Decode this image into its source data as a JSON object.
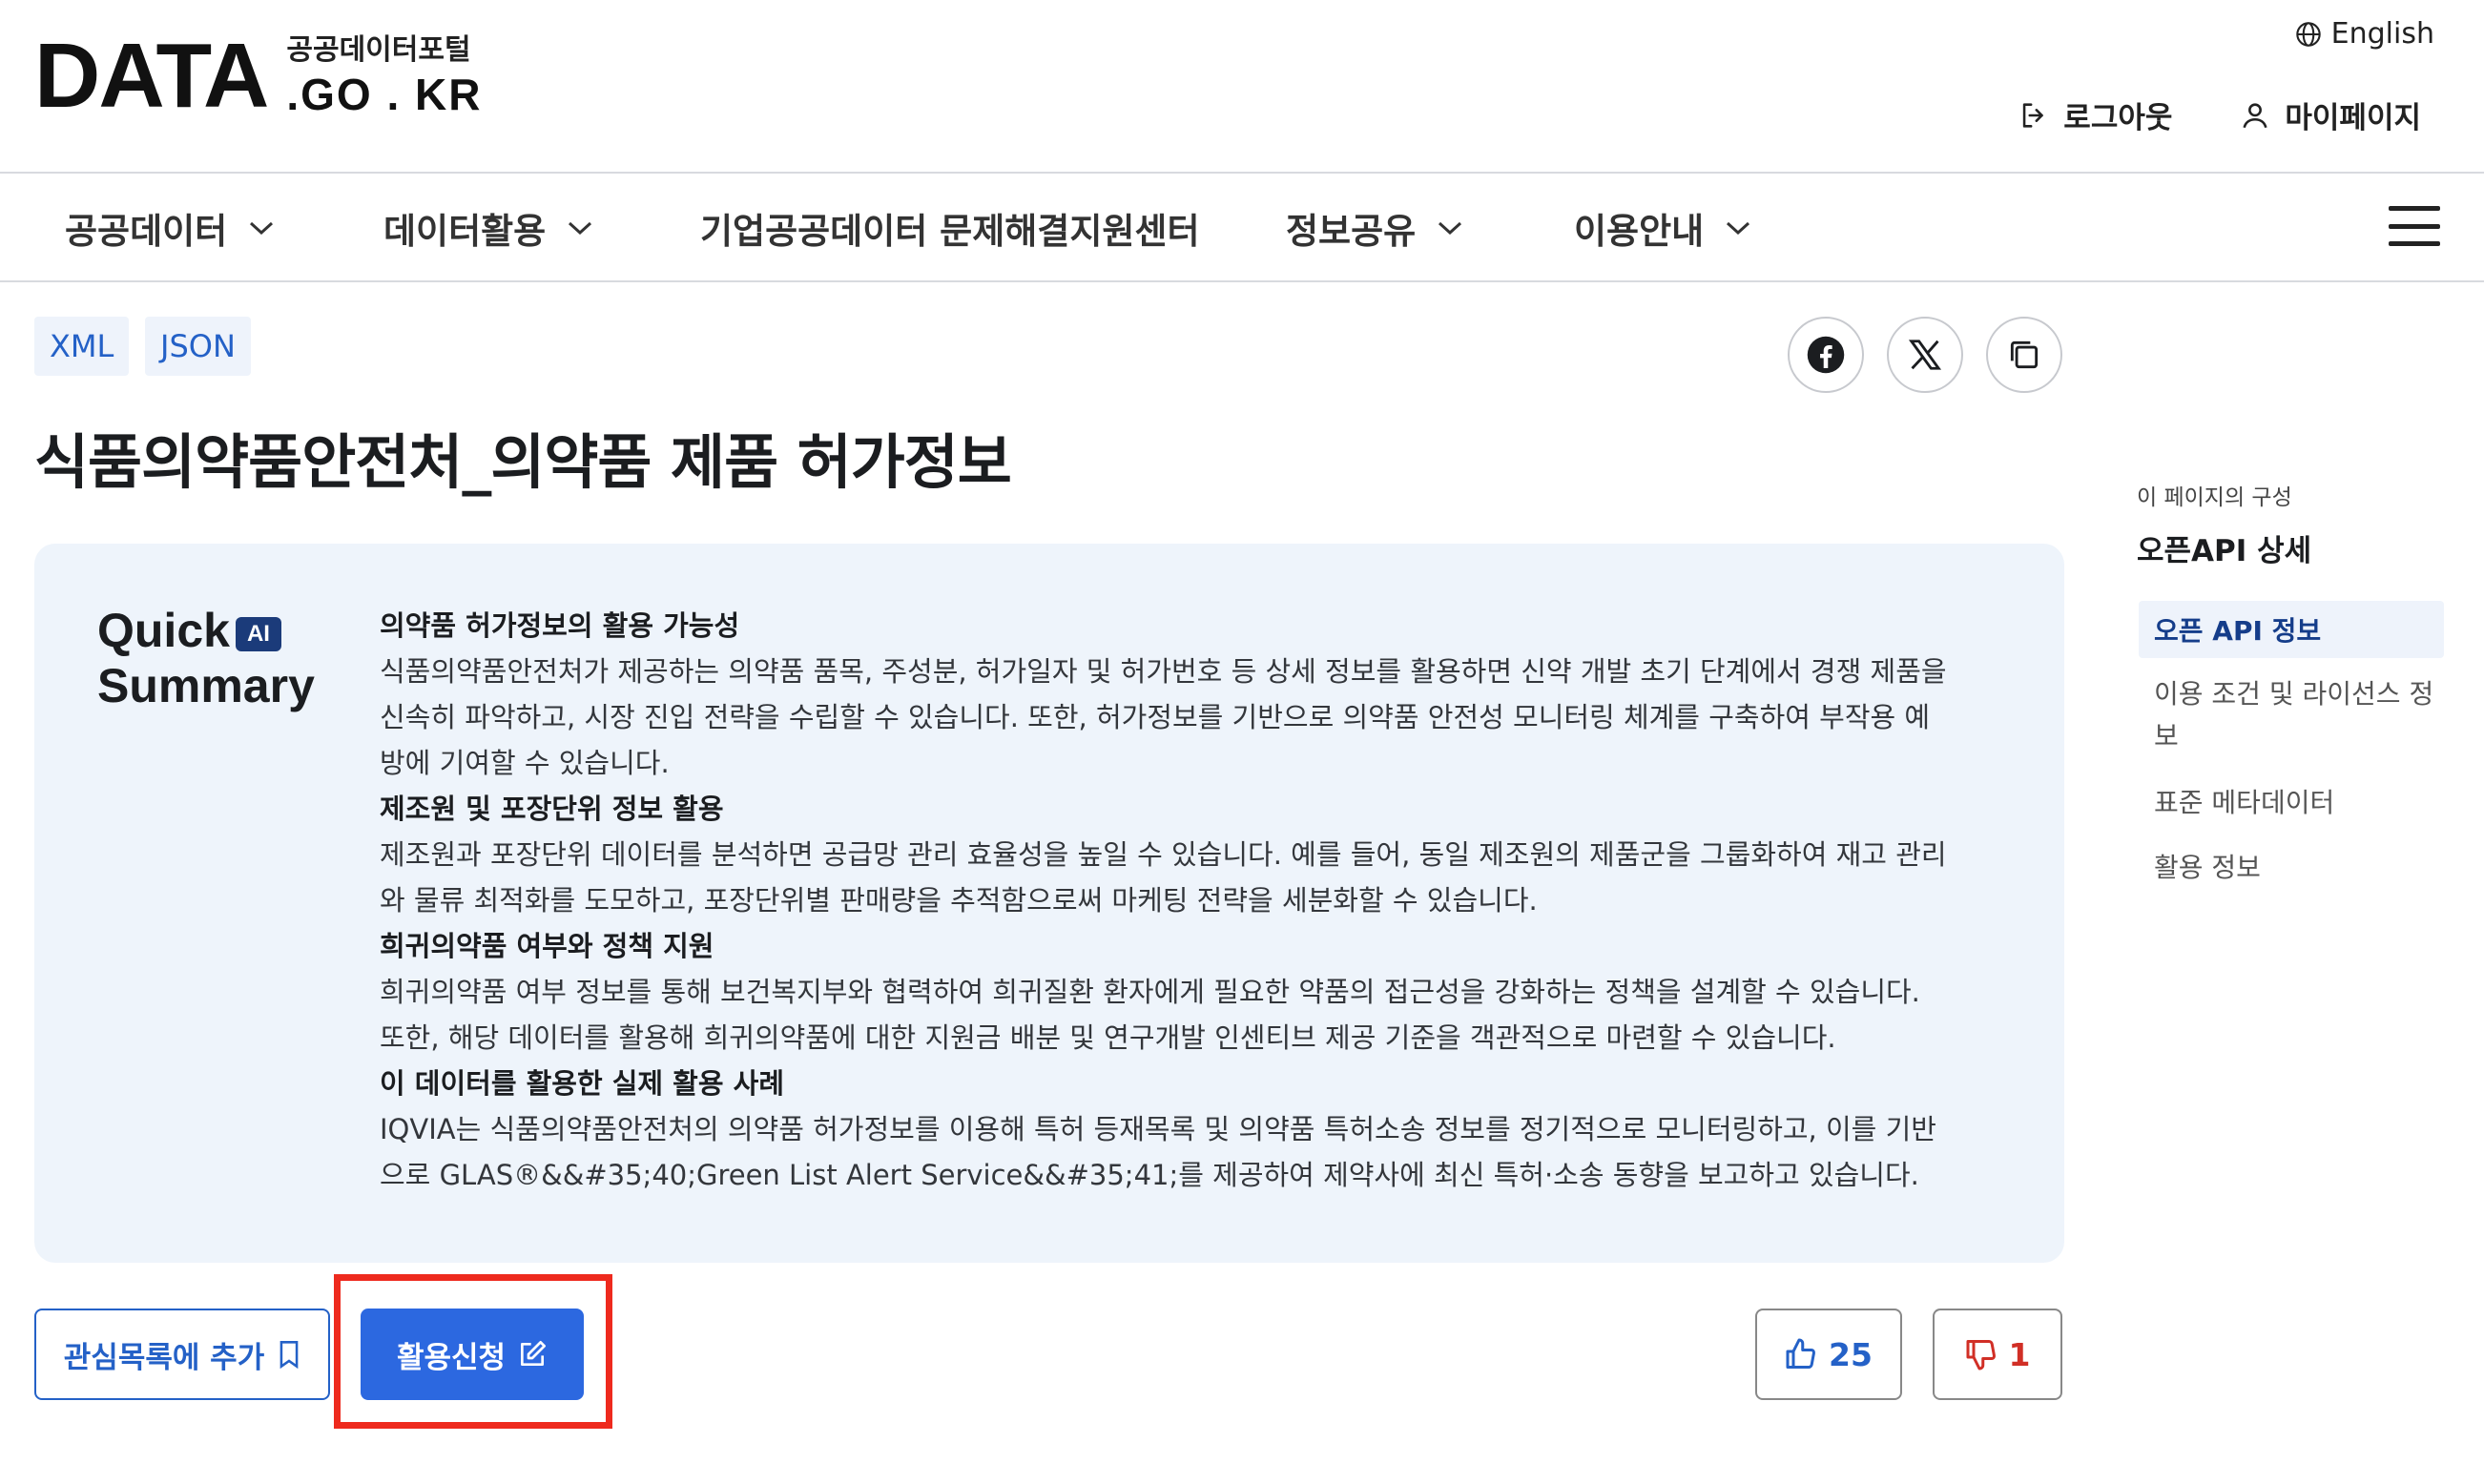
{
  "header": {
    "logo_main": "DATA",
    "logo_kr": "공공데이터포털",
    "logo_domain": ".GO . KR",
    "language": "English",
    "logout": "로그아웃",
    "mypage": "마이페이지"
  },
  "nav": {
    "items": [
      {
        "label": "공공데이터"
      },
      {
        "label": "데이터활용"
      },
      {
        "label": "기업공공데이터 문제해결지원센터"
      },
      {
        "label": "정보공유"
      },
      {
        "label": "이용안내"
      }
    ]
  },
  "tags": [
    "XML",
    "JSON"
  ],
  "page_title": "식품의약품안전처_의약품 제품 허가정보",
  "summary": {
    "title_line1": "Quick",
    "badge": "AI",
    "title_line2": "Summary",
    "sections": [
      {
        "heading": "의약품 허가정보의 활용 가능성",
        "lines": [
          "식품의약품안전처가 제공하는 의약품 품목, 주성분, 허가일자 및 허가번호 등 상세 정보를 활용하면 신약 개발 초기 단계에서 경쟁 제품을",
          "신속히 파악하고, 시장 진입 전략을 수립할 수 있습니다. 또한, 허가정보를 기반으로 의약품 안전성 모니터링 체계를 구축하여 부작용 예",
          "방에 기여할 수 있습니다."
        ]
      },
      {
        "heading": "제조원 및 포장단위 정보 활용",
        "lines": [
          "제조원과 포장단위 데이터를 분석하면 공급망 관리 효율성을 높일 수 있습니다. 예를 들어, 동일 제조원의 제품군을 그룹화하여 재고 관리",
          "와 물류 최적화를 도모하고, 포장단위별 판매량을 추적함으로써 마케팅 전략을 세분화할 수 있습니다."
        ]
      },
      {
        "heading": "희귀의약품 여부와 정책 지원",
        "lines": [
          "희귀의약품 여부 정보를 통해 보건복지부와 협력하여 희귀질환 환자에게 필요한 약품의 접근성을 강화하는 정책을 설계할 수 있습니다.",
          "또한, 해당 데이터를 활용해 희귀의약품에 대한 지원금 배분 및 연구개발 인센티브 제공 기준을 객관적으로 마련할 수 있습니다."
        ]
      },
      {
        "heading": "이 데이터를 활용한 실제 활용 사례",
        "lines": [
          "IQVIA는 식품의약품안전처의 의약품 허가정보를 이용해 특허 등재목록 및 의약품 특허소송 정보를 정기적으로 모니터링하고, 이를 기반",
          "으로 GLAS®&&#35;40;Green List Alert Service&&#35;41;를 제공하여 제약사에 최신 특허·소송 동향을 보고하고 있습니다."
        ]
      }
    ]
  },
  "toc": {
    "caption": "이 페이지의 구성",
    "title": "오픈API 상세",
    "active": "오픈 API 정보",
    "items": [
      "이용 조건 및 라이선스 정보",
      "표준 메타데이터",
      "활용 정보"
    ]
  },
  "actions": {
    "wishlist": "관심목록에 추가",
    "apply": "활용신청",
    "likes": "25",
    "dislikes": "1"
  },
  "colors": {
    "primary": "#2c68e0",
    "link_blue": "#2461c7",
    "summary_bg": "#eef4fb",
    "highlight_red": "#ee2a1e",
    "dislike_red": "#d12f26"
  }
}
